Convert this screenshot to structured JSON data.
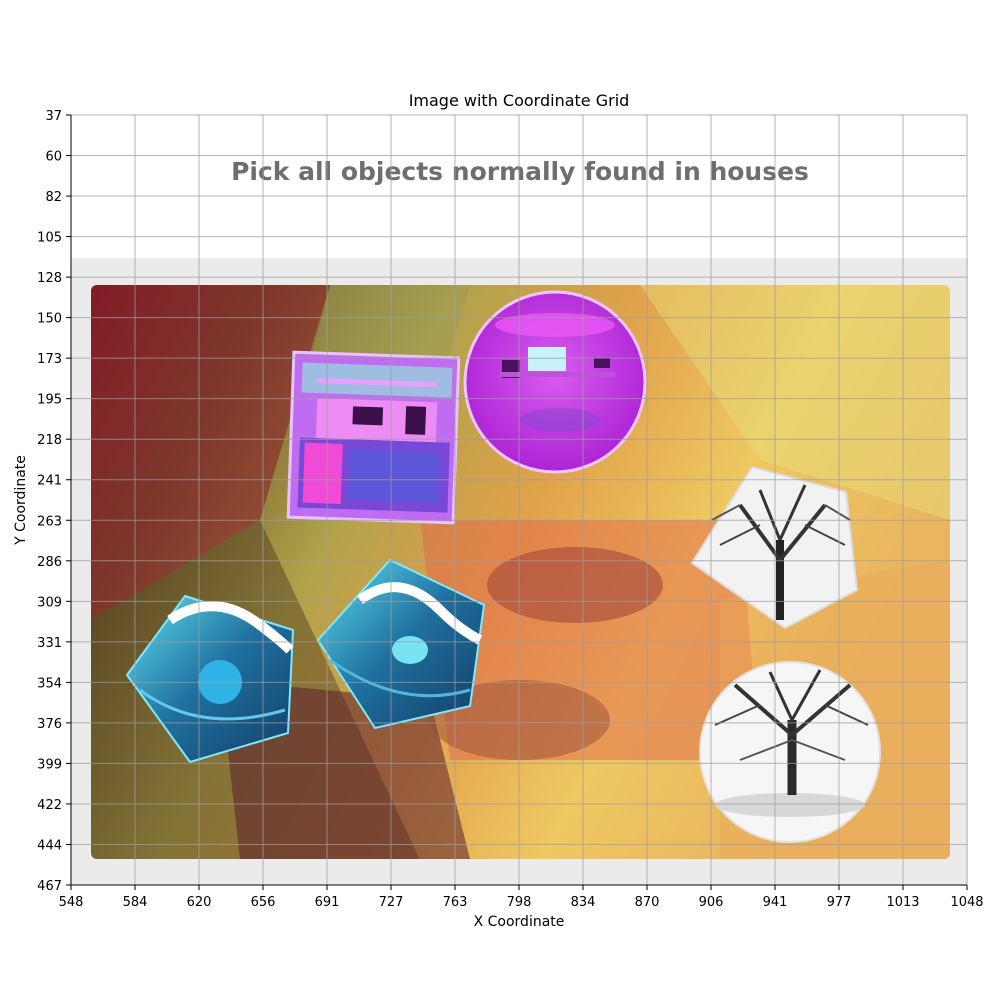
{
  "figure": {
    "title": "Image with Coordinate Grid",
    "xlabel": "X Coordinate",
    "ylabel": "Y Coordinate",
    "x_ticks": [
      "548",
      "584",
      "620",
      "656",
      "691",
      "727",
      "763",
      "798",
      "834",
      "870",
      "906",
      "941",
      "977",
      "1013",
      "1048"
    ],
    "y_ticks": [
      "37",
      "60",
      "82",
      "105",
      "128",
      "150",
      "173",
      "195",
      "218",
      "241",
      "263",
      "286",
      "309",
      "331",
      "354",
      "376",
      "399",
      "422",
      "444",
      "467"
    ],
    "grid": true
  },
  "captcha": {
    "instruction": "Pick all objects normally found in houses",
    "instruction_color": "#6e6e6e",
    "panel_color": "#ebebeb",
    "tiles": [
      {
        "id": "kitchen-square",
        "subject": "kitchen interior",
        "shape": "square"
      },
      {
        "id": "kitchen-circle",
        "subject": "kitchen interior",
        "shape": "circle"
      },
      {
        "id": "tree-pentagon",
        "subject": "tree",
        "shape": "pentagon"
      },
      {
        "id": "wave-pentagon-left",
        "subject": "wave",
        "shape": "pentagon"
      },
      {
        "id": "wave-pentagon-center",
        "subject": "wave",
        "shape": "pentagon"
      },
      {
        "id": "tree-circle",
        "subject": "tree",
        "shape": "circle"
      }
    ]
  }
}
